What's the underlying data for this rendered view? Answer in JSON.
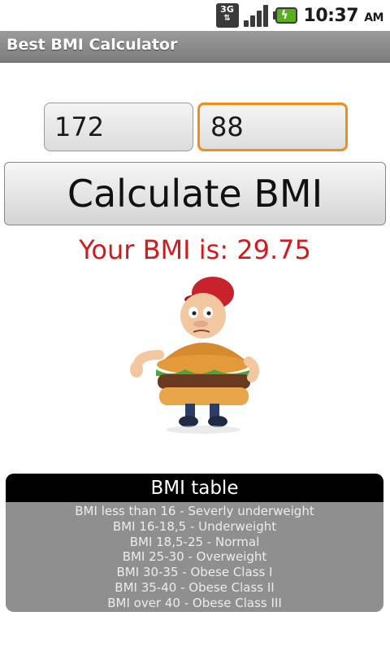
{
  "status_bar": {
    "network": "3G",
    "time": "10:37",
    "ampm": "AM"
  },
  "app": {
    "title": "Best BMI Calculator"
  },
  "inputs": {
    "height_value": "172",
    "weight_value": "88"
  },
  "calculate_button": {
    "label": "Calculate BMI"
  },
  "result": {
    "text": "Your BMI is: 29.75"
  },
  "bmi_table": {
    "header": "BMI table",
    "rows": [
      "BMI less than 16 - Severly underweight",
      "BMI 16-18,5 - Underweight",
      "BMI 18,5-25 - Normal",
      "BMI 25-30 - Overweight",
      "BMI 30-35 - Obese Class I",
      "BMI 35-40 - Obese Class II",
      "BMI over 40 - Obese Class III"
    ]
  },
  "colors": {
    "result_text": "#d41b1b",
    "focused_input_border": "#f08d1c",
    "table_header_bg": "#000000",
    "table_body_bg": "#8f8f8f"
  },
  "icons": {
    "network": "3g-data-icon",
    "signal": "signal-strength-icon",
    "battery": "battery-charging-icon",
    "illustration": "overweight-burger-man-thumbs-down-image"
  }
}
